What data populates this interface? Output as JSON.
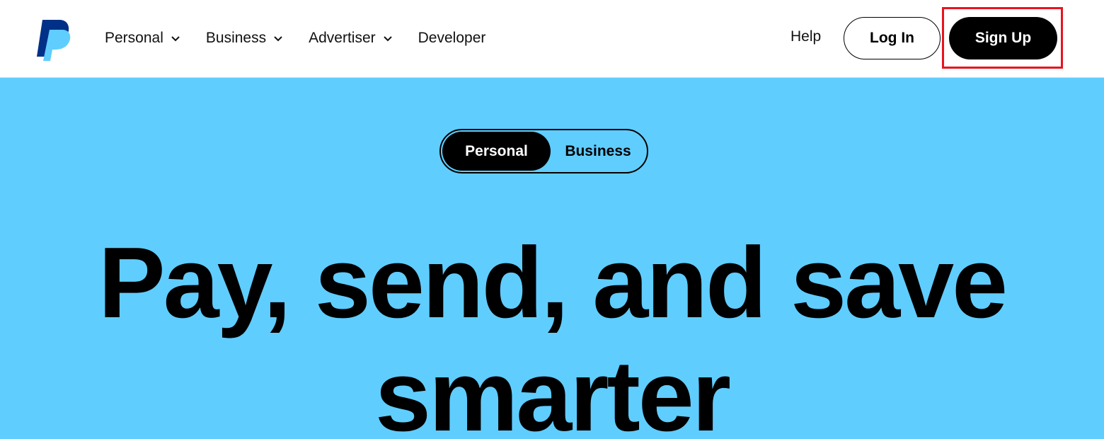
{
  "brand": {
    "logo": "paypal-logo",
    "colors": {
      "dark_blue": "#003087",
      "light_blue": "#60cdff"
    }
  },
  "nav": {
    "items": [
      {
        "label": "Personal",
        "has_dropdown": true
      },
      {
        "label": "Business",
        "has_dropdown": true
      },
      {
        "label": "Advertiser",
        "has_dropdown": true
      },
      {
        "label": "Developer",
        "has_dropdown": false
      }
    ],
    "help_label": "Help",
    "login_label": "Log In",
    "signup_label": "Sign Up"
  },
  "hero": {
    "background_color": "#60cdff",
    "toggle": {
      "active": "Personal",
      "inactive": "Business"
    },
    "headline_line1": "Pay, send, and save",
    "headline_line2": "smarter"
  },
  "annotation": {
    "highlight_color": "#e8141e"
  }
}
